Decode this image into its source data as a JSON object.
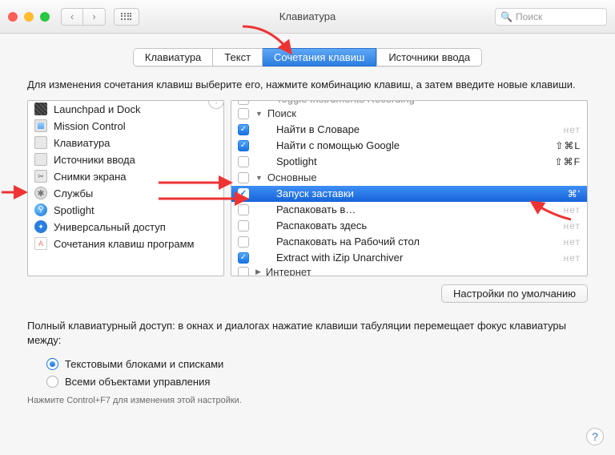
{
  "window": {
    "title": "Клавиатура"
  },
  "search": {
    "placeholder": "Поиск"
  },
  "tabs": [
    {
      "label": "Клавиатура",
      "active": false
    },
    {
      "label": "Текст",
      "active": false
    },
    {
      "label": "Сочетания клавиш",
      "active": true
    },
    {
      "label": "Источники ввода",
      "active": false
    }
  ],
  "instructions": "Для изменения сочетания клавиш выберите его, нажмите комбинацию клавиш, а затем введите новые клавиши.",
  "categories": [
    {
      "label": "Launchpad и Dock",
      "icon": "lp"
    },
    {
      "label": "Mission Control",
      "icon": "mc"
    },
    {
      "label": "Клавиатура",
      "icon": "kb"
    },
    {
      "label": "Источники ввода",
      "icon": "inp"
    },
    {
      "label": "Снимки экрана",
      "icon": "scr"
    },
    {
      "label": "Службы",
      "icon": "svc",
      "selected": true
    },
    {
      "label": "Spotlight",
      "icon": "spot"
    },
    {
      "label": "Универсальный доступ",
      "icon": "acc"
    },
    {
      "label": "Сочетания клавиш программ",
      "icon": "app"
    }
  ],
  "services": {
    "top_cut": "Toggle Instruments Recording",
    "groups": [
      {
        "name": "Поиск",
        "checked": false,
        "items": [
          {
            "label": "Найти в Словаре",
            "checked": true,
            "shortcut": "нет",
            "dim": true
          },
          {
            "label": "Найти с помощью Google",
            "checked": true,
            "shortcut": "⇧⌘L"
          },
          {
            "label": "Spotlight",
            "checked": false,
            "shortcut": "⇧⌘F"
          }
        ]
      },
      {
        "name": "Основные",
        "checked": false,
        "items": [
          {
            "label": "Запуск заставки",
            "checked": true,
            "shortcut": "⌘'",
            "selected": true
          },
          {
            "label": "Распаковать в…",
            "checked": false,
            "shortcut": "нет",
            "dim": true
          },
          {
            "label": "Распаковать здесь",
            "checked": false,
            "shortcut": "нет",
            "dim": true
          },
          {
            "label": "Распаковать на Рабочий стол",
            "checked": false,
            "shortcut": "нет",
            "dim": true
          },
          {
            "label": "Extract with iZip Unarchiver",
            "checked": true,
            "shortcut": "нет",
            "dim": true
          }
        ]
      }
    ],
    "bottom_cut": "Интернет"
  },
  "defaults_button": "Настройки по умолчанию",
  "kbaccess": {
    "text": "Полный клавиатурный доступ: в окнах и диалогах нажатие клавиши табуляции перемещает фокус клавиатуры между:",
    "option1": "Текстовыми блоками и списками",
    "option2": "Всеми объектами управления",
    "hint": "Нажмите Control+F7 для изменения этой настройки."
  }
}
